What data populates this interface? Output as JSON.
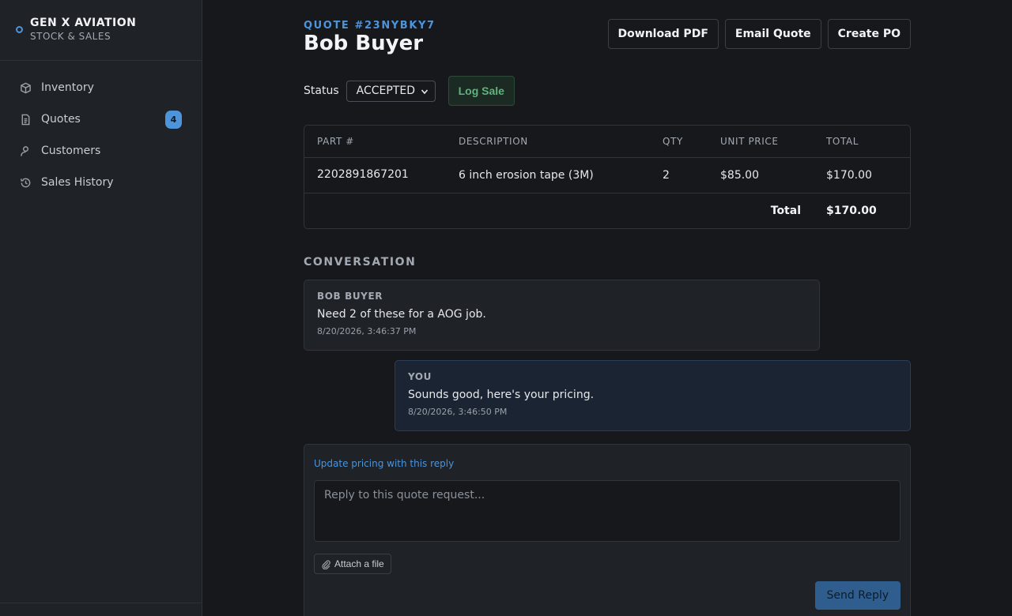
{
  "brand": {
    "title": "GEN X AVIATION",
    "subtitle": "STOCK & SALES",
    "accent_color": "#4d94db"
  },
  "sidebar": {
    "items": [
      {
        "label": "Inventory",
        "icon": "box-icon"
      },
      {
        "label": "Quotes",
        "icon": "document-icon",
        "badge": "4",
        "active": true
      },
      {
        "label": "Customers",
        "icon": "user-icon"
      },
      {
        "label": "Sales History",
        "icon": "history-icon"
      }
    ]
  },
  "quote": {
    "number": "QUOTE #23NYBKY7",
    "customer": "Bob Buyer"
  },
  "toolbar": {
    "download_pdf": "Download PDF",
    "email_quote": "Email Quote",
    "create_po": "Create PO"
  },
  "status": {
    "label": "Status",
    "value": "ACCEPTED",
    "log_sale": "Log Sale"
  },
  "table": {
    "headers": [
      "PART #",
      "DESCRIPTION",
      "QTY",
      "UNIT PRICE",
      "TOTAL"
    ],
    "rows": [
      {
        "part": "2202891867201",
        "description": "6 inch erosion tape (3M)",
        "qty": "2",
        "unit_price": "$85.00",
        "total": "$170.00"
      }
    ],
    "footer_label": "Total",
    "footer_value": "$170.00"
  },
  "conversation": {
    "title": "CONVERSATION",
    "messages": [
      {
        "author": "BOB BUYER",
        "body": "Need 2 of these for a AOG job.",
        "time": "8/20/2026, 3:46:37 PM"
      },
      {
        "author": "YOU",
        "body": "Sounds good, here's your pricing.",
        "time": "8/20/2026, 3:46:50 PM"
      }
    ]
  },
  "reply": {
    "update_pricing_link": "Update pricing with this reply",
    "placeholder": "Reply to this quote request...",
    "attach_label": "Attach a file",
    "send_label": "Send Reply"
  }
}
